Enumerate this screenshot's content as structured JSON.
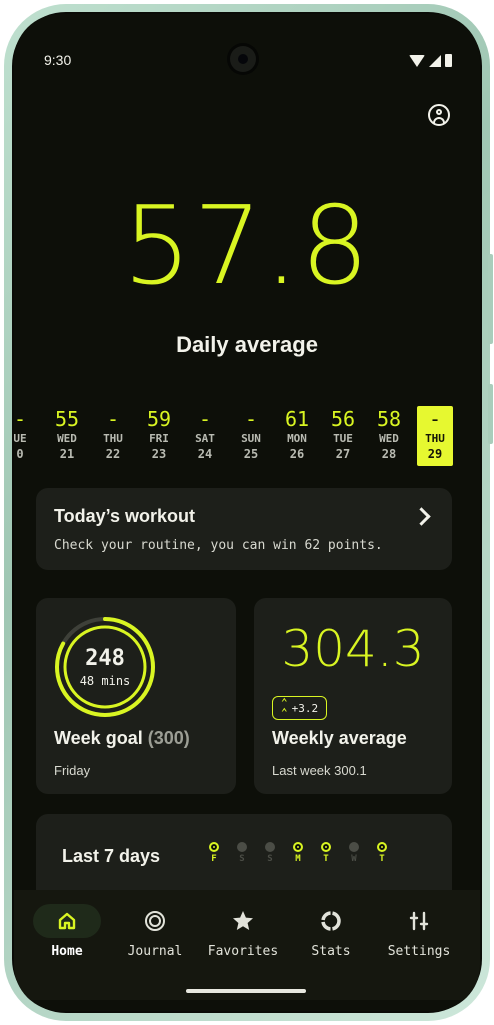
{
  "status": {
    "time": "9:30"
  },
  "summary": {
    "value": "57.8",
    "label": "Daily average"
  },
  "days": [
    {
      "value": "-",
      "day": "UE",
      "date": "0"
    },
    {
      "value": "55",
      "day": "WED",
      "date": "21"
    },
    {
      "value": "-",
      "day": "THU",
      "date": "22"
    },
    {
      "value": "59",
      "day": "FRI",
      "date": "23"
    },
    {
      "value": "-",
      "day": "SAT",
      "date": "24"
    },
    {
      "value": "-",
      "day": "SUN",
      "date": "25"
    },
    {
      "value": "61",
      "day": "MON",
      "date": "26"
    },
    {
      "value": "56",
      "day": "TUE",
      "date": "27"
    },
    {
      "value": "58",
      "day": "WED",
      "date": "28"
    },
    {
      "value": "-",
      "day": "THU",
      "date": "29"
    }
  ],
  "workout": {
    "title": "Today’s workout",
    "subtitle": "Check your routine, you can win 62 points."
  },
  "week_goal": {
    "value": "248",
    "unit": "48 mins",
    "title": "Week goal",
    "goal": "(300)",
    "day": "Friday",
    "progress_fraction": 0.83
  },
  "weekly_average": {
    "value": "304.3",
    "change": "+3.2",
    "last_week": "Last week 300.1"
  },
  "last7": {
    "title": "Last 7 days",
    "days": [
      {
        "letter": "F",
        "done": true
      },
      {
        "letter": "S",
        "done": false
      },
      {
        "letter": "S",
        "done": false
      },
      {
        "letter": "M",
        "done": true
      },
      {
        "letter": "T",
        "done": true
      },
      {
        "letter": "W",
        "done": false
      },
      {
        "letter": "T",
        "done": true
      }
    ]
  },
  "nav": [
    {
      "label": "Home",
      "icon": "home-icon",
      "active": true
    },
    {
      "label": "Journal",
      "icon": "journal-icon",
      "active": false
    },
    {
      "label": "Favorites",
      "icon": "star-icon",
      "active": false
    },
    {
      "label": "Stats",
      "icon": "stats-icon",
      "active": false
    },
    {
      "label": "Settings",
      "icon": "settings-icon",
      "active": false
    }
  ],
  "colors": {
    "accent": "#d9f522",
    "background": "#0d0f09",
    "card": "#1d1f1a"
  }
}
